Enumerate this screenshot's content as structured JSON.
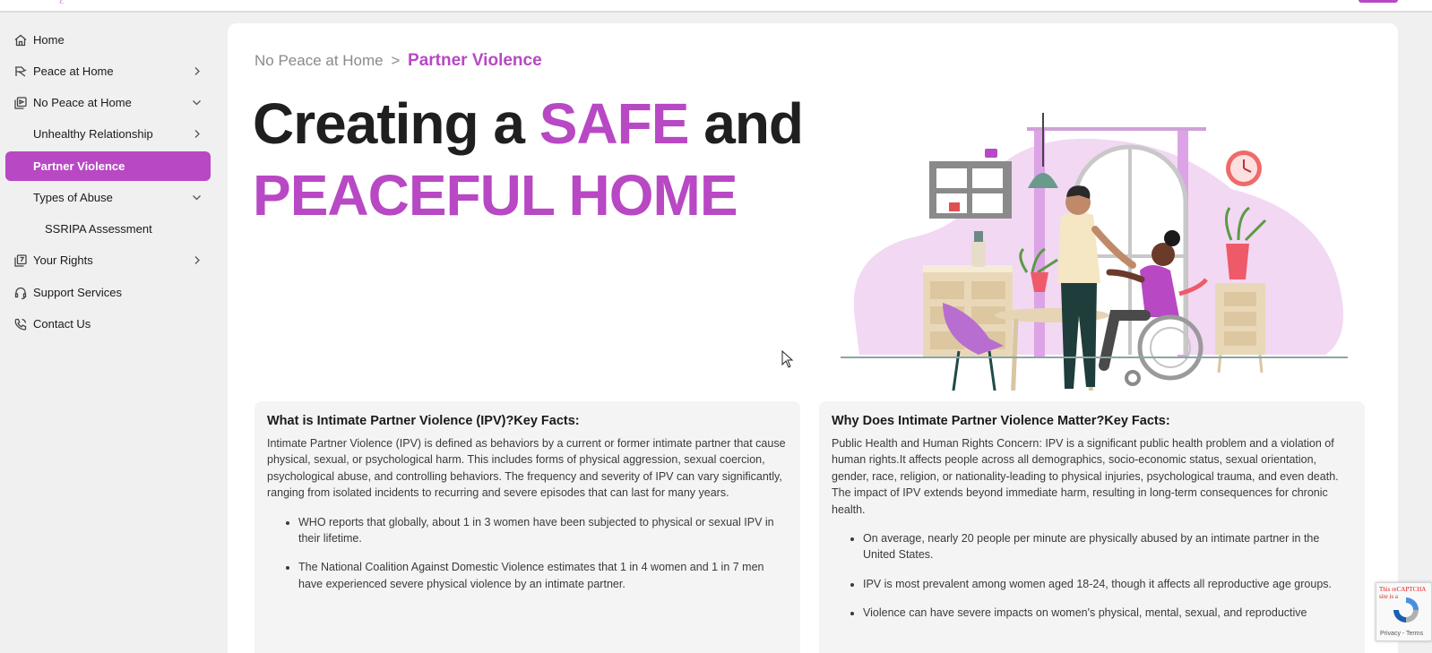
{
  "topbar": {
    "logo_glyph": "ℰ"
  },
  "sidebar": {
    "items": [
      {
        "label": "Home",
        "icon": "home-icon",
        "chevron": "none"
      },
      {
        "label": "Peace at Home",
        "icon": "peace-icon",
        "chevron": "right"
      },
      {
        "label": "No Peace at Home",
        "icon": "gallery-icon",
        "chevron": "down"
      },
      {
        "label": "Unhealthy Relationship",
        "icon": "",
        "chevron": "right"
      },
      {
        "label": "Partner Violence",
        "icon": "",
        "chevron": "none",
        "active": true
      },
      {
        "label": "Types of Abuse",
        "icon": "",
        "chevron": "down"
      },
      {
        "label": "SSRIPA Assessment",
        "icon": "",
        "chevron": "none"
      },
      {
        "label": "Your Rights",
        "icon": "rights-icon",
        "chevron": "right"
      },
      {
        "label": "Support Services",
        "icon": "headset-icon",
        "chevron": "none"
      },
      {
        "label": "Contact Us",
        "icon": "phone-icon",
        "chevron": "none"
      }
    ]
  },
  "breadcrumb": {
    "parent": "No Peace at Home",
    "separator": ">",
    "current": "Partner Violence"
  },
  "hero": {
    "line1_prefix": "Creating a ",
    "line1_accent": "SAFE",
    "line1_suffix": " and",
    "line2": "PEACEFUL HOME"
  },
  "cards": [
    {
      "title": "What is Intimate Partner Violence (IPV)?Key Facts:",
      "body": "Intimate Partner Violence (IPV) is defined as behaviors by a current or former intimate partner that cause physical, sexual, or psychological harm. This includes forms of physical aggression, sexual coercion, psychological abuse, and controlling behaviors. The frequency and severity of IPV can vary significantly, ranging from isolated incidents to recurring and severe episodes that can last for many years.",
      "bullets": [
        "WHO reports that globally, about 1 in 3 women have been subjected to physical or sexual IPV in their lifetime.",
        "The National Coalition Against Domestic Violence estimates that 1 in 4 women and 1 in 7 men have experienced severe physical violence by an intimate partner."
      ]
    },
    {
      "title": "Why Does Intimate Partner Violence Matter?Key Facts:",
      "body": "Public Health and Human Rights Concern: IPV is a significant public health problem and a violation of human rights.It affects people across all demographics, socio-economic status, sexual orientation, gender, race, religion, or nationality-leading to physical injuries, psychological trauma, and even death. The impact of IPV extends beyond immediate harm, resulting in long-term consequences for chronic health.",
      "bullets": [
        "On average, nearly 20 people per minute are physically abused by an intimate partner in the United States.",
        "IPV is most prevalent among women aged 18-24, though it affects all reproductive age groups.",
        "Violence can have severe impacts on women's physical, mental, sexual, and reproductive"
      ]
    }
  ],
  "captcha": {
    "notice": "This reCAPTCHA site is a",
    "links": "Privacy - Terms"
  },
  "colors": {
    "accent": "#b848c4",
    "sidebar_bg": "#f0f0f0",
    "card_bg": "#f4f4f4"
  }
}
